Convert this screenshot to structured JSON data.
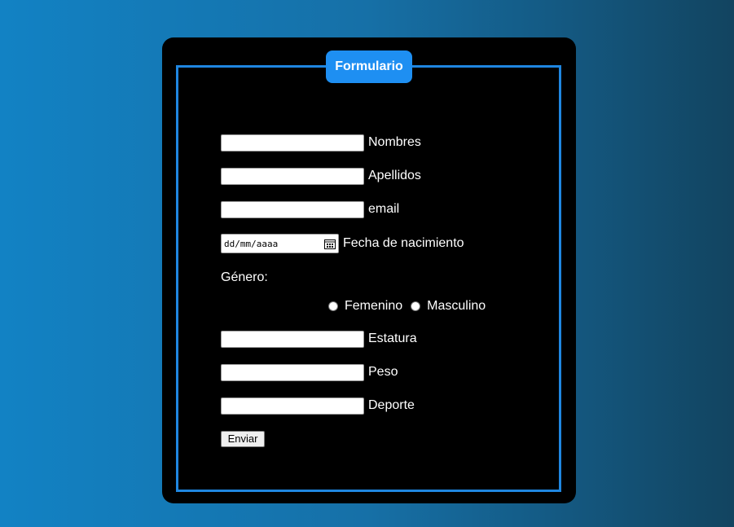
{
  "form": {
    "legend": "Formulario",
    "fields": {
      "nombres": "Nombres",
      "apellidos": "Apellidos",
      "email": "email",
      "fecha": "Fecha de nacimiento",
      "fecha_placeholder": "dd/mm/aaaa",
      "genero": "Género:",
      "femenino": "Femenino",
      "masculino": "Masculino",
      "estatura": "Estatura",
      "peso": "Peso",
      "deporte": "Deporte"
    },
    "submit_label": "Enviar"
  },
  "colors": {
    "accent": "#1e8ff2",
    "card": "#000000",
    "text": "#ffffff"
  },
  "icons": {
    "date_picker": "calendar-icon"
  }
}
